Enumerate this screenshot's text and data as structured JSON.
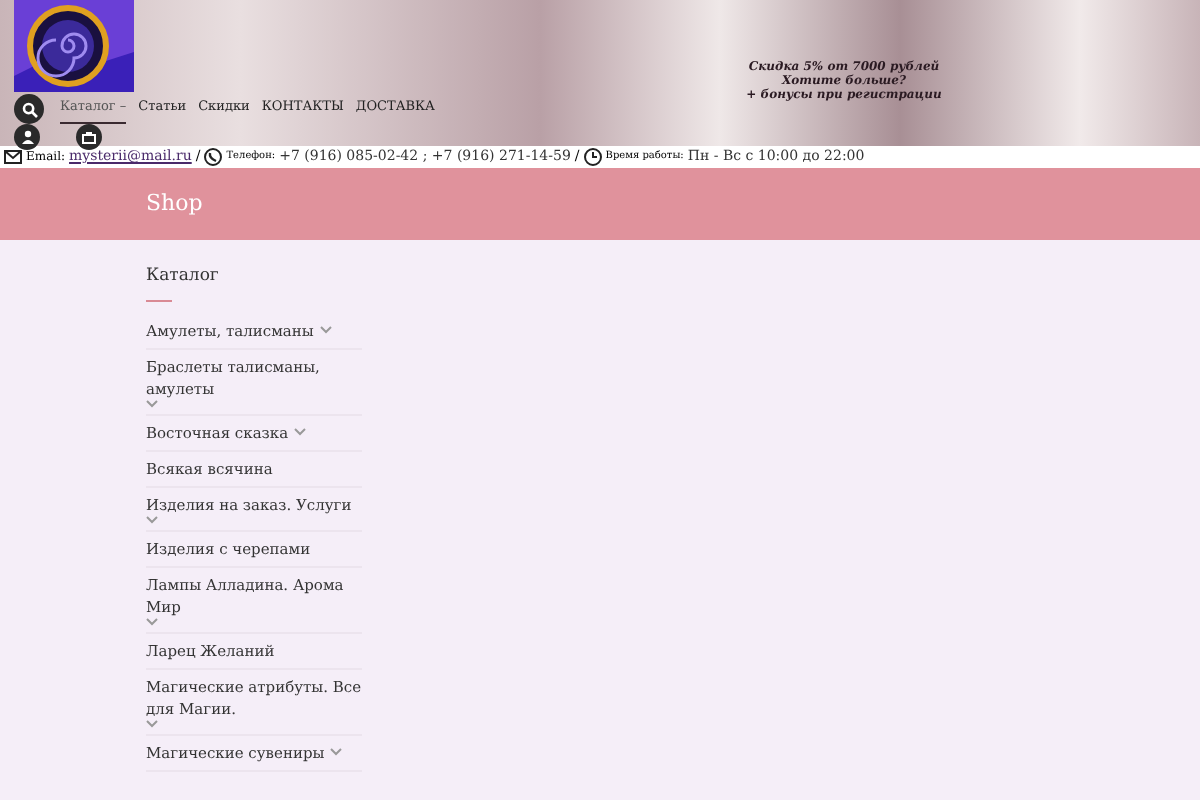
{
  "header": {
    "promo_lines": [
      "Скидка 5% от 7000 рублей",
      "Хотите больше?",
      "+ бонусы при регистрации"
    ]
  },
  "nav": [
    {
      "label": "Каталог –",
      "selected": true
    },
    {
      "label": "Статьи",
      "selected": false
    },
    {
      "label": "Скидки",
      "selected": false
    },
    {
      "label": "КОНТАКТЫ",
      "selected": false
    },
    {
      "label": "ДОСТАВКА",
      "selected": false
    }
  ],
  "contact_bar": {
    "email_label": "Email:",
    "email": "mysterii@mail.ru",
    "separator_1": "/",
    "phone_label": "Телефон:",
    "phones": "+7 (916) 085-02-42 ; +7 (916) 271-14-59",
    "separator_2": "/",
    "hours_label": "Время работы:",
    "hours": "Пн - Вс с 10:00 до 22:00"
  },
  "page_title": "Shop",
  "sidebar": {
    "title": "Каталог",
    "items": [
      {
        "label": "Амулеты, талисманы",
        "has_submenu": true
      },
      {
        "label": "Браслеты талисманы, амулеты",
        "has_submenu": true
      },
      {
        "label": "Восточная сказка",
        "has_submenu": true
      },
      {
        "label": "Всякая всячина",
        "has_submenu": false
      },
      {
        "label": "Изделия на заказ. Услуги",
        "has_submenu": true
      },
      {
        "label": "Изделия с черепами",
        "has_submenu": false
      },
      {
        "label": "Лампы Алладина. Арома Мир",
        "has_submenu": true
      },
      {
        "label": "Ларец Желаний",
        "has_submenu": false
      },
      {
        "label": "Магические атрибуты. Все для Магии.",
        "has_submenu": true
      },
      {
        "label": "Магические сувениры",
        "has_submenu": true
      }
    ]
  }
}
